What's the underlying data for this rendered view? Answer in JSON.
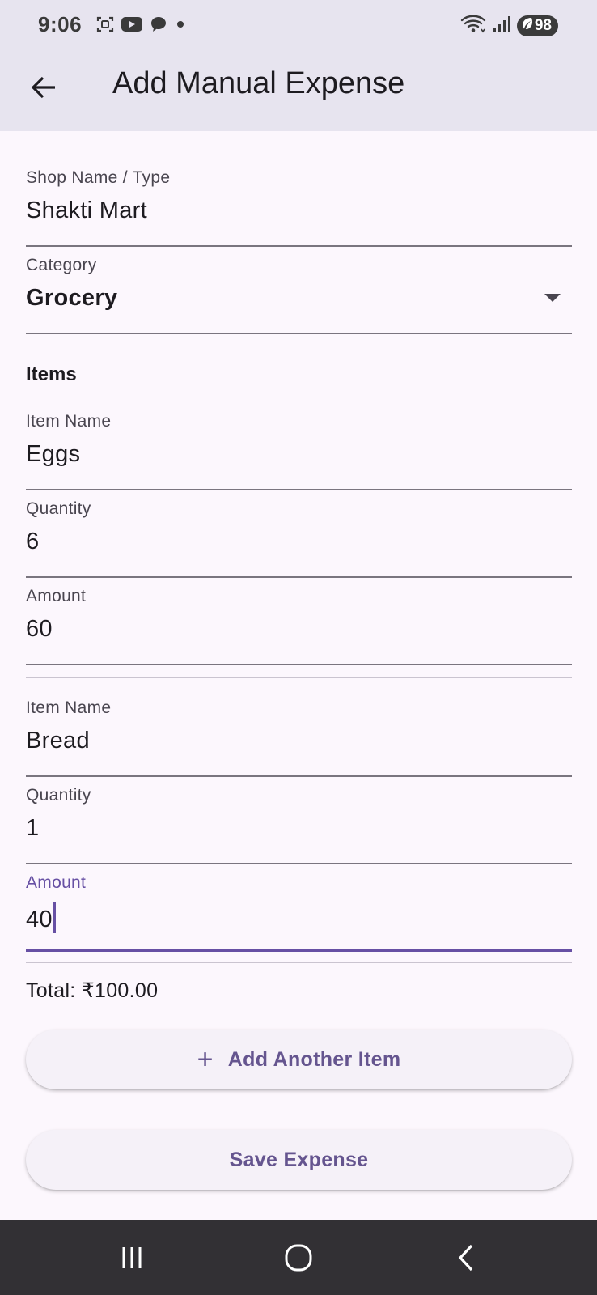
{
  "status_bar": {
    "time": "9:06",
    "left_icons": [
      "screenshot-icon",
      "youtube-icon",
      "chat-icon",
      "dot-icon"
    ],
    "right_icons": [
      "wifi-icon",
      "signal-icon"
    ],
    "battery": "98"
  },
  "app_bar": {
    "title": "Add Manual Expense",
    "back_icon": "arrow-left-icon"
  },
  "form": {
    "shop": {
      "label": "Shop Name / Type",
      "value": "Shakti Mart"
    },
    "category": {
      "label": "Category",
      "value": "Grocery"
    },
    "items_heading": "Items",
    "items": [
      {
        "name": {
          "label": "Item Name",
          "value": "Eggs"
        },
        "quantity": {
          "label": "Quantity",
          "value": "6"
        },
        "amount": {
          "label": "Amount",
          "value": "60"
        }
      },
      {
        "name": {
          "label": "Item Name",
          "value": "Bread"
        },
        "quantity": {
          "label": "Quantity",
          "value": "1"
        },
        "amount": {
          "label": "Amount",
          "value": "40"
        }
      }
    ],
    "total": "Total: ₹100.00",
    "add_item_label": "Add Another Item",
    "save_label": "Save Expense"
  },
  "colors": {
    "accent": "#6750a4",
    "button_text": "#65558f",
    "header_bg": "#e7e4ef",
    "page_bg": "#fcf7fd",
    "nav_bg": "#323034"
  },
  "nav_bar": {
    "icons": [
      "recents-icon",
      "home-icon",
      "back-icon"
    ]
  }
}
